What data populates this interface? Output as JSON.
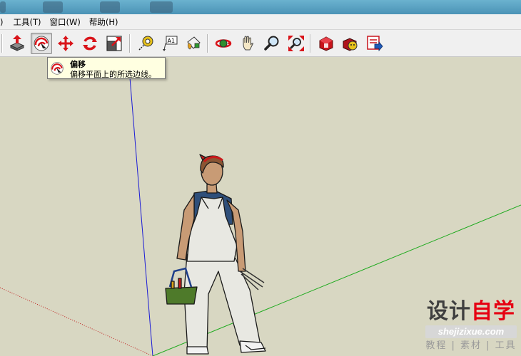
{
  "menu": {
    "items": [
      {
        "label": ")"
      },
      {
        "label": "工具(T)"
      },
      {
        "label": "窗口(W)"
      },
      {
        "label": "帮助(H)"
      }
    ]
  },
  "toolbar": {
    "text_tool_glyph": "A1",
    "pressed_tool": "offset"
  },
  "tooltip": {
    "title": "偏移",
    "description": "偏移平面上的所选边线。"
  },
  "watermark": {
    "part1": "设计",
    "part2": "自学",
    "url": "shejizixue.com",
    "tagline": "教程 | 素材 | 工具"
  },
  "colors": {
    "viewport": "#d8d7c2",
    "axis_blue": "#1c1cd6",
    "axis_green": "#1faa1f",
    "axis_red": "#c01a1a",
    "tooltip_bg": "#ffffe1",
    "brand_red": "#e60012"
  }
}
